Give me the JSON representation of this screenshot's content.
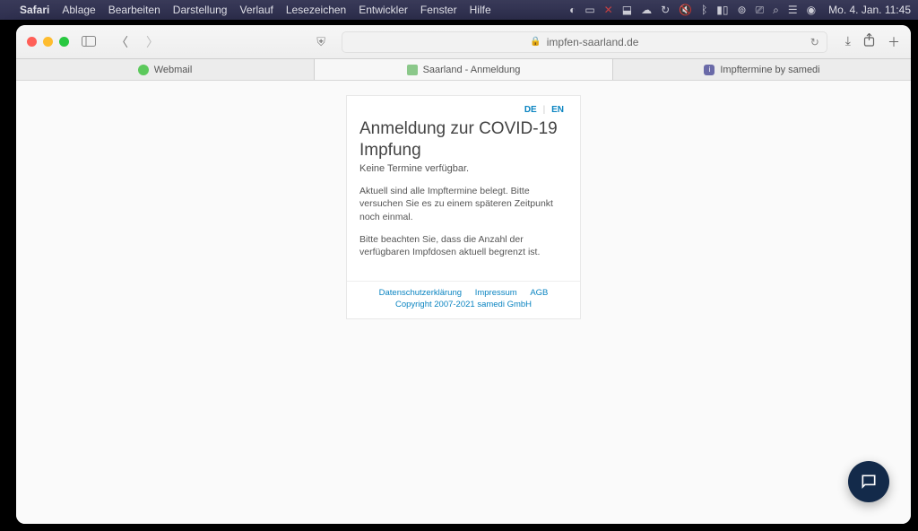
{
  "menubar": {
    "app": "Safari",
    "items": [
      "Ablage",
      "Bearbeiten",
      "Darstellung",
      "Verlauf",
      "Lesezeichen",
      "Entwickler",
      "Fenster",
      "Hilfe"
    ],
    "clock": "Mo. 4. Jan.  11:45"
  },
  "toolbar": {
    "address": "impfen-saarland.de"
  },
  "tabs": [
    {
      "label": "Webmail",
      "fav": "green"
    },
    {
      "label": "Saarland - Anmeldung",
      "fav": "leaf",
      "active": true
    },
    {
      "label": "Impftermine by samedi",
      "fav": "purple"
    }
  ],
  "page": {
    "lang_de": "DE",
    "lang_en": "EN",
    "title": "Anmeldung zur COVID-19 Impfung",
    "subtitle": "Keine Termine verfügbar.",
    "p1": "Aktuell sind alle Impftermine belegt. Bitte versuchen Sie es zu einem späteren Zeitpunkt noch einmal.",
    "p2": "Bitte beachten Sie, dass die Anzahl der verfügbaren Impfdosen aktuell begrenzt ist.",
    "footer": {
      "privacy": "Datenschutzerklärung",
      "imprint": "Impressum",
      "agb": "AGB",
      "copyright": "Copyright 2007-2021 samedi GmbH"
    }
  }
}
